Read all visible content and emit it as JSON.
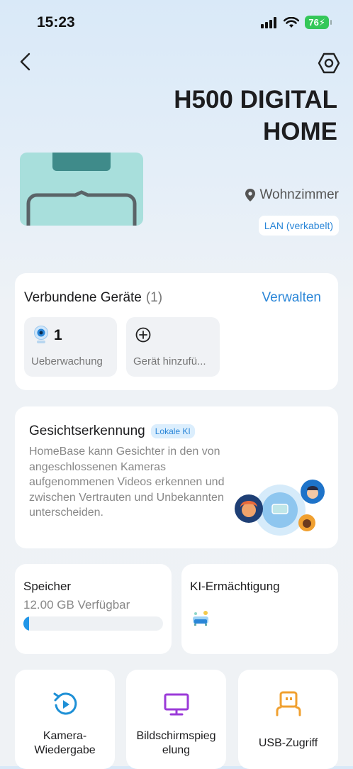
{
  "status_bar": {
    "time": "15:23",
    "battery": "76"
  },
  "device": {
    "title": "H500 DIGITAL HOME",
    "location": "Wohnzimmer",
    "connection": "LAN (verkabelt)"
  },
  "connected_devices": {
    "title": "Verbundene Geräte",
    "count": "(1)",
    "manage_label": "Verwalten",
    "surveillance_count": "1",
    "surveillance_label": "Ueberwachung",
    "add_device_label": "Gerät hinzufü..."
  },
  "face_recognition": {
    "title": "Gesichtserkennung",
    "badge": "Lokale KI",
    "description": "HomeBase kann Gesichter in den von angeschlossenen Kameras aufgenommenen Videos erkennen und zwischen Vertrauten und Unbekannten unterscheiden."
  },
  "storage": {
    "title": "Speicher",
    "available": "12.00 GB Verfügbar",
    "used_fraction": 0.04
  },
  "ki_empowerment": {
    "title": "KI-Ermächtigung"
  },
  "quick_actions": [
    {
      "label": "Kamera-\nWiedergabe",
      "icon": "playback-icon"
    },
    {
      "label": "Bildschirmspieg\nelung",
      "icon": "monitor-icon"
    },
    {
      "label": "USB-Zugriff",
      "icon": "usb-icon"
    }
  ],
  "colors": {
    "accent": "#2a86d8",
    "playback": "#1e90d6",
    "monitor": "#9b3ad8",
    "usb": "#f0a030"
  }
}
